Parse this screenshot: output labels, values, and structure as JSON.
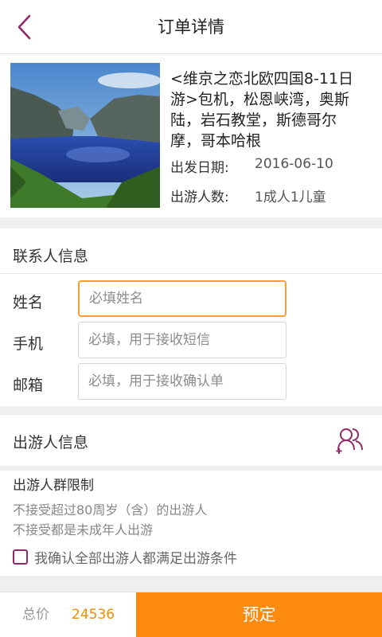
{
  "header": {
    "title": "订单详情"
  },
  "product": {
    "title": "<维京之恋北欧四国8-11日游>包机，松恩峡湾，奥斯陆，岩石教堂，斯德哥尔摩，哥本哈根",
    "departure_label": "出发日期:",
    "departure_value": "2016-06-10",
    "travelers_label": "出游人数:",
    "travelers_value": "1成人1儿童"
  },
  "contact": {
    "title": "联系人信息",
    "name_label": "姓名",
    "name_placeholder": "必填姓名",
    "phone_label": "手机",
    "phone_placeholder": "必填，用于接收短信",
    "email_label": "邮箱",
    "email_placeholder": "必填，用于接收确认单"
  },
  "traveler_section": {
    "title": "出游人信息",
    "icon": "add-traveler-icon"
  },
  "restrictions": {
    "title": "出游人群限制",
    "lines": [
      "不接受超过80周岁（含）的出游人",
      "不接受都是未成年人出游"
    ],
    "confirm_label": "我确认全部出游人都满足出游条件"
  },
  "footer": {
    "total_label": "总价",
    "total_value": "24536",
    "book_label": "预定"
  },
  "colors": {
    "accent": "#fb8a0e",
    "brand_purple": "#8e2a68",
    "focus_border": "#f5a030"
  }
}
